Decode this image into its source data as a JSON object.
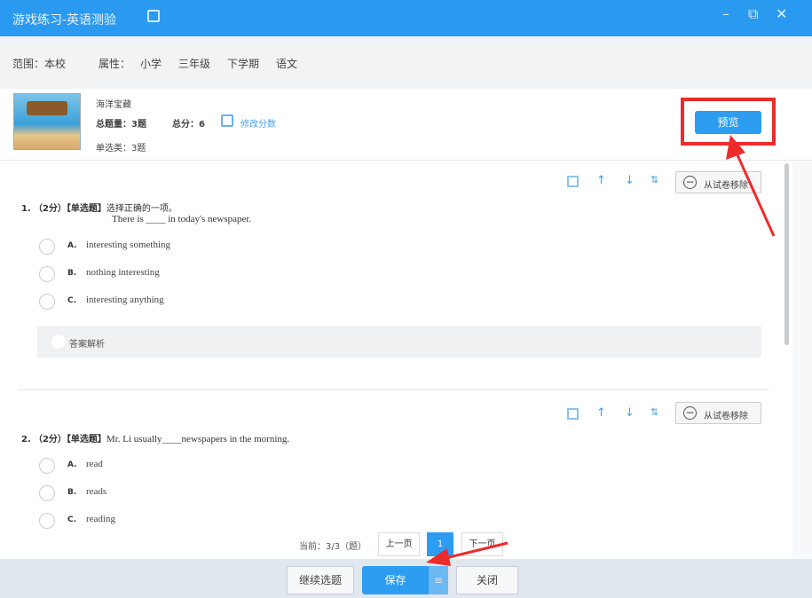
{
  "window": {
    "title": "游戏练习-英语测验",
    "minimize": "–",
    "restore": "⧉",
    "close": "✕"
  },
  "filter": {
    "scope_label": "范围：本校",
    "attr_label": "属性：",
    "attrs": [
      "小学",
      "三年级",
      "下学期",
      "语文"
    ]
  },
  "info": {
    "name": "海洋宝藏",
    "total_count": "总题量：3题",
    "total_score": "总分：6",
    "edit_score": "修改分数",
    "single_choice": "单选类：3题",
    "preview": "预览"
  },
  "questions": [
    {
      "num": "1.",
      "meta": "（2分）【单选题】",
      "prompt": "选择正确的一项。",
      "sentence": "There is ____ in today's newspaper.",
      "options": [
        {
          "letter": "A.",
          "text": "interesting something"
        },
        {
          "letter": "B.",
          "text": "nothing interesting"
        },
        {
          "letter": "C.",
          "text": "interesting anything"
        }
      ],
      "analysis": "答案解析",
      "remove": "从试卷移除"
    },
    {
      "num": "2.",
      "meta": "（2分）【单选题】",
      "sentence": "Mr. Li usually____newspapers in the morning.",
      "options": [
        {
          "letter": "A.",
          "text": "read"
        },
        {
          "letter": "B.",
          "text": "reads"
        },
        {
          "letter": "C.",
          "text": "reading"
        }
      ],
      "remove": "从试卷移除"
    }
  ],
  "pager": {
    "current": "当前：3/3（题）",
    "prev": "上一页",
    "page": "1",
    "next": "下一页"
  },
  "footer": {
    "continue": "继续选题",
    "save": "保存",
    "save_menu": "≡",
    "close": "关闭"
  },
  "colors": {
    "accent": "#2a9af0",
    "annotation": "#ee2b2b"
  }
}
